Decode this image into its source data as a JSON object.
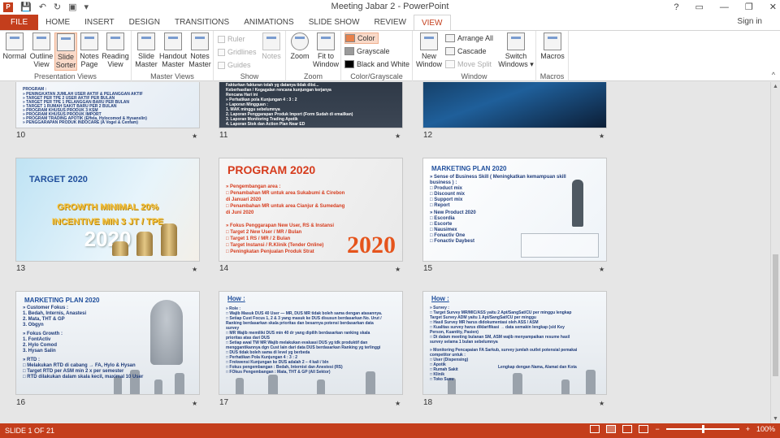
{
  "app": {
    "title": "Meeting Jabar 2 - PowerPoint",
    "window_controls": [
      "?",
      "▭",
      "—",
      "❐",
      "✕"
    ],
    "qat_icons": [
      "powerpoint-icon",
      "save-icon",
      "undo-icon",
      "redo-icon",
      "start-slideshow-icon",
      "customize-icon"
    ]
  },
  "tabs": [
    {
      "label": "FILE"
    },
    {
      "label": "HOME"
    },
    {
      "label": "INSERT"
    },
    {
      "label": "DESIGN"
    },
    {
      "label": "TRANSITIONS"
    },
    {
      "label": "ANIMATIONS"
    },
    {
      "label": "SLIDE SHOW"
    },
    {
      "label": "REVIEW"
    },
    {
      "label": "VIEW"
    }
  ],
  "signin": "Sign in",
  "ribbon": {
    "presentation_views": {
      "label": "Presentation Views",
      "buttons": [
        {
          "l1": "Normal",
          "l2": ""
        },
        {
          "l1": "Outline",
          "l2": "View"
        },
        {
          "l1": "Slide",
          "l2": "Sorter"
        },
        {
          "l1": "Notes",
          "l2": "Page"
        },
        {
          "l1": "Reading",
          "l2": "View"
        }
      ]
    },
    "master_views": {
      "label": "Master Views",
      "buttons": [
        {
          "l1": "Slide",
          "l2": "Master"
        },
        {
          "l1": "Handout",
          "l2": "Master"
        },
        {
          "l1": "Notes",
          "l2": "Master"
        }
      ]
    },
    "show": {
      "label": "Show",
      "items": [
        "Ruler",
        "Gridlines",
        "Guides"
      ],
      "notes": "Notes"
    },
    "zoom": {
      "label": "Zoom",
      "zoom": "Zoom",
      "fit_l1": "Fit to",
      "fit_l2": "Window"
    },
    "color": {
      "label": "Color/Grayscale",
      "items": [
        "Color",
        "Grayscale",
        "Black and White"
      ],
      "swatches": [
        "#e8804a",
        "#9a9a9a",
        "#000000"
      ]
    },
    "window": {
      "label": "Window",
      "new_l1": "New",
      "new_l2": "Window",
      "items": [
        "Arrange All",
        "Cascade",
        "Move Split"
      ],
      "switch_l1": "Switch",
      "switch_l2": "Windows ▾"
    },
    "macros": {
      "label": "Macros",
      "button": "Macros"
    },
    "collapse": "^"
  },
  "slides": [
    {
      "num": "10",
      "lines": [
        "PROGRAM :",
        "» PENINGKATAN JUMLAH USER AKTIF & PELANGGAN AKTIF",
        "  » TARGET PER TPE 2 USER AKTIF PER BULAN",
        "  » TARGET PER TPE 1 PELANGGAN BARU PER BULAN",
        "  » TARGET 1 RUMAH SAKIT BARU PER 2 BULAN",
        "» PROGRAM KHUSUS PRODUK 3 KSM",
        "» PROGRAM KHUSUS PRODUK IMPORT",
        "» PROGRAM TRADING APOTIK (Effela, Hylocomod & Hysanslin)",
        "» PENGGARAPAN PRODUK INDOCARE (A Vogel & Cenfam)"
      ]
    },
    {
      "num": "11",
      "lines": [
        "Fakturkan fakturan tolah yg datanya tidak diisi...",
        "  Keberhasilan / Kegagalan rencana kunjungan kerjanya",
        "  Rencana Hari ini",
        "» Perhatikan pola Kunjungan 4 : 3 : 2",
        "» Laporan Mingguan :",
        "  1. MAK minggu sebelumnya",
        "  2. Laporan Penggarapan Produk Import (Form Sudah di emailkan)",
        "  3. Laporan Monitoring Trading Apotik",
        "  4. Laporan Stok dan Action Plan Near ED"
      ]
    },
    {
      "num": "12"
    },
    {
      "num": "13",
      "title": "TARGET 2020",
      "big1": "GROWTH MINIMAL 20%",
      "big2": "INCENTIVE MIN 3 JT / TPE",
      "year": "2020"
    },
    {
      "num": "14",
      "title": "PROGRAM 2020",
      "year": "2020",
      "lines": [
        "» Pengembangan area :",
        "  □ Penambahan MR untuk area Sukabumi & Cirebon",
        "     di Januari 2020",
        "  □ Penambahan MR untuk area Cianjur & Sumedang",
        "     di Juni 2020",
        "",
        "» Fokus Penggarapan New User, RS & Instansi",
        "  □ Target 2 New User / MR / Bulan",
        "  □ Target 1 RS / MR / 2 Bulan",
        "  □ Target Instansi / R.Klinik (Tender Online)",
        "  □ Peningkatan Penjualan Produk Strat"
      ]
    },
    {
      "num": "15",
      "title": "MARKETING PLAN 2020",
      "lines": [
        "» Sense of Business Skill ( Meningkatkan kemampuan skill",
        "   business ) :",
        "  □ Product mix",
        "  □ Discount mix",
        "  □ Support mix",
        "  □ Report",
        "» New Product 2020",
        "  □ Escordia",
        "  □ Escorte",
        "  □ Nausimex",
        "  □ Fonactiv One",
        "  □ Fonactiv Daybest"
      ]
    },
    {
      "num": "16",
      "title": "MARKETING PLAN 2020",
      "lines": [
        "» Customer Fokus :",
        "  1. Bedah, Internis, Anastesi",
        "  2. Mata, THT & GP",
        "  3. Obgyn",
        "",
        "» Fokus Growth :",
        "  1. FontActiv",
        "  2. Hylo Comod",
        "  3. Hysan Salin",
        "",
        "» RTD :",
        "  □ Melakukan RTD di cabang → FA, Hylo & Hysan",
        "  □ Target RTD per ASM min 2 x per semester",
        "  □ RTD dilakukan dalam skala kecil, maximal 10 User"
      ]
    },
    {
      "num": "17",
      "title": "How :",
      "lines": [
        "» Role :",
        "  □ Wajib Masuk DUS 40 User — MR, DUS MR tidak boleh sama dengan atasannya.",
        "  □ Setiap Cust Focus 1, 2 & 3 yang masuk ke DUS disusun berdasarkan No. Urut /",
        "     Ranking berdasarkan skala prioritas dan besarnya potensi berdasarkan data",
        "     survey",
        "  □ MR Wajib memiliki DUS min 40 dr yang dipilih berdasarkan ranking skala",
        "     prioritas atas dari DUS",
        "  □ Setiap awal TW MR Wajib melakukan evaluasi DUS yg tdk produktif dan",
        "     menggantikannya dgn Cust lain dari data DUS berdasarkan Ranking yg terlinggi",
        "  □ DUS tidak boleh sama di level yg berbeda",
        "  □ Perhatikan Pola Kunjungan 4 : 3 : 2",
        "  □ Frekwensi Kunjungan ke DUS adalah 2 – 4 kali / bln",
        "  □ Fokus pengembangan : Bedah, Internist dan Anestesi (RS)",
        "  □ FOkus Pengembangan : Mata, THT & GP (All Sektor)"
      ]
    },
    {
      "num": "18",
      "title": "How :",
      "callout": "Lengkap dengan Nama, Alamat dan Kota",
      "lines": [
        "» Survey :",
        "  □ Target Survey MR/MIC/ASS yaitu 2 Apt/SangSat/CU per minggu lengkap",
        "     Target Survey ADM yaitu 1 Apt/SangSat/CU per minggu",
        "  □ Hasil Survey MR harus didokumentasi oleh ASS / ASM",
        "  □ Kualitas survey harus diklarifikasi → data semakin lengkap (s/d Key",
        "     Person, Kuantity, Pasien)",
        "  □ Di dalam meeting bulanan SM, ASM wajib menyampaikan resume hasil",
        "     survey selama 1 bulan sebelumnya",
        "",
        "» Monitoring Pencapaian FA Sarkub, survey jumlah outlet potensial pemakai",
        "   competitor untuk :",
        "  □ User (Dispensing)",
        "  □ Apotik",
        "  □ Rumah Sakit",
        "  □ Klinik",
        "  □ Toko Susu"
      ]
    }
  ],
  "star": "★",
  "status": {
    "slide_info": "SLIDE 1 OF 21",
    "zoom": "100%",
    "zoom_minus": "−",
    "zoom_plus": "+"
  }
}
